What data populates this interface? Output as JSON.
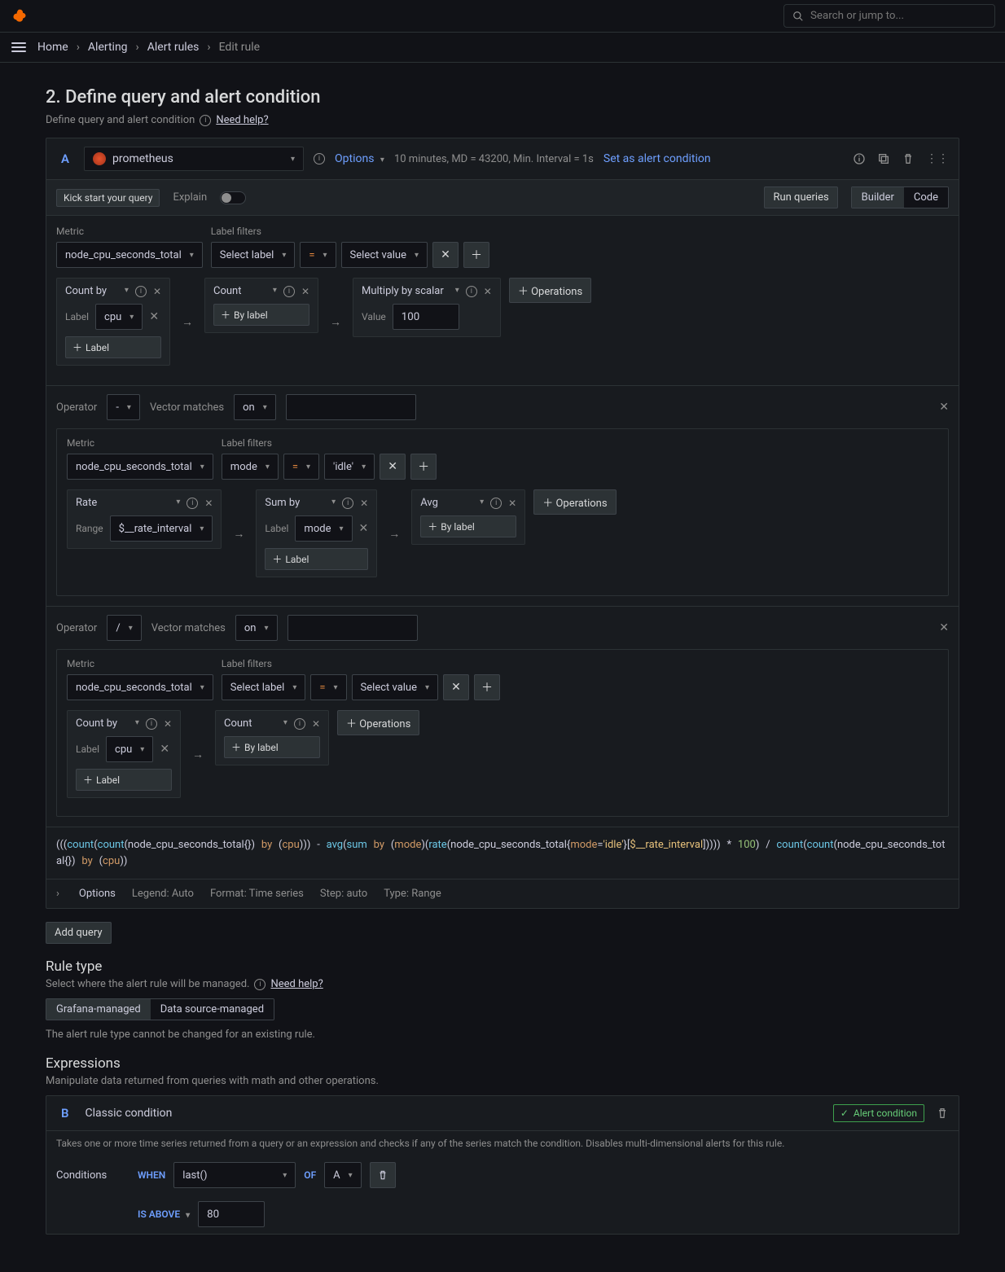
{
  "search_placeholder": "Search or jump to...",
  "breadcrumbs": [
    "Home",
    "Alerting",
    "Alert rules",
    "Edit rule"
  ],
  "page": {
    "title": "2. Define query and alert condition",
    "subtitle": "Define query and alert condition",
    "need_help": "Need help?"
  },
  "query": {
    "ref": "A",
    "datasource": "prometheus",
    "options_label": "Options",
    "interval_text": "10 minutes, MD = 43200, Min. Interval = 1s",
    "set_condition": "Set as alert condition",
    "kickstart": "Kick start your query",
    "explain": "Explain",
    "run_queries": "Run queries",
    "builder": "Builder",
    "code": "Code",
    "metric_label": "Metric",
    "label_filters_label": "Label filters",
    "metric1": "node_cpu_seconds_total",
    "select_label": "Select label",
    "eq": "=",
    "select_value": "Select value",
    "operations_btn": "Operations",
    "op1": {
      "title": "Count by",
      "label_k": "Label",
      "label_v": "cpu",
      "add_label": "Label"
    },
    "op2": {
      "title": "Count",
      "by_label": "By label"
    },
    "op3": {
      "title": "Multiply by scalar",
      "value_k": "Value",
      "value_v": "100"
    },
    "bin1": {
      "operator_label": "Operator",
      "operator": "-",
      "vm_label": "Vector matches",
      "vm": "on"
    },
    "nested1": {
      "metric": "node_cpu_seconds_total",
      "filter_label": "mode",
      "filter_op": "=",
      "filter_value": "'idle'",
      "rate": {
        "title": "Rate",
        "range_k": "Range",
        "range_v": "$__rate_interval"
      },
      "sumby": {
        "title": "Sum by",
        "label_k": "Label",
        "label_v": "mode",
        "add_label": "Label"
      },
      "avg": {
        "title": "Avg",
        "by_label": "By label"
      }
    },
    "bin2": {
      "operator_label": "Operator",
      "operator": "/",
      "vm_label": "Vector matches",
      "vm": "on"
    },
    "nested2": {
      "metric": "node_cpu_seconds_total",
      "countby": {
        "title": "Count by",
        "label_k": "Label",
        "label_v": "cpu",
        "add_label": "Label"
      },
      "count": {
        "title": "Count",
        "by_label": "By label"
      }
    },
    "code_preview": "(((count(count(node_cpu_seconds_total{}) by (cpu))) - avg(sum by (mode)(rate(node_cpu_seconds_total{mode='idle'}[$__rate_interval])))) * 100) / count(count(node_cpu_seconds_total{}) by (cpu))",
    "options_row": {
      "options": "Options",
      "legend": "Legend: Auto",
      "format": "Format: Time series",
      "step": "Step: auto",
      "type": "Type: Range"
    }
  },
  "add_query": "Add query",
  "rule_type": {
    "title": "Rule type",
    "desc": "Select where the alert rule will be managed.",
    "need_help": "Need help?",
    "grafana": "Grafana-managed",
    "ds": "Data source-managed",
    "locked": "The alert rule type cannot be changed for an existing rule."
  },
  "expressions": {
    "title": "Expressions",
    "desc": "Manipulate data returned from queries with math and other operations."
  },
  "expr": {
    "ref": "B",
    "name": "Classic condition",
    "badge": "Alert condition",
    "desc": "Takes one or more time series returned from a query or an expression and checks if any of the series match the condition. Disables multi-dimensional alerts for this rule.",
    "conditions": "Conditions",
    "when": "WHEN",
    "func": "last()",
    "of": "OF",
    "of_ref": "A",
    "is_above": "IS ABOVE",
    "threshold": "80"
  }
}
